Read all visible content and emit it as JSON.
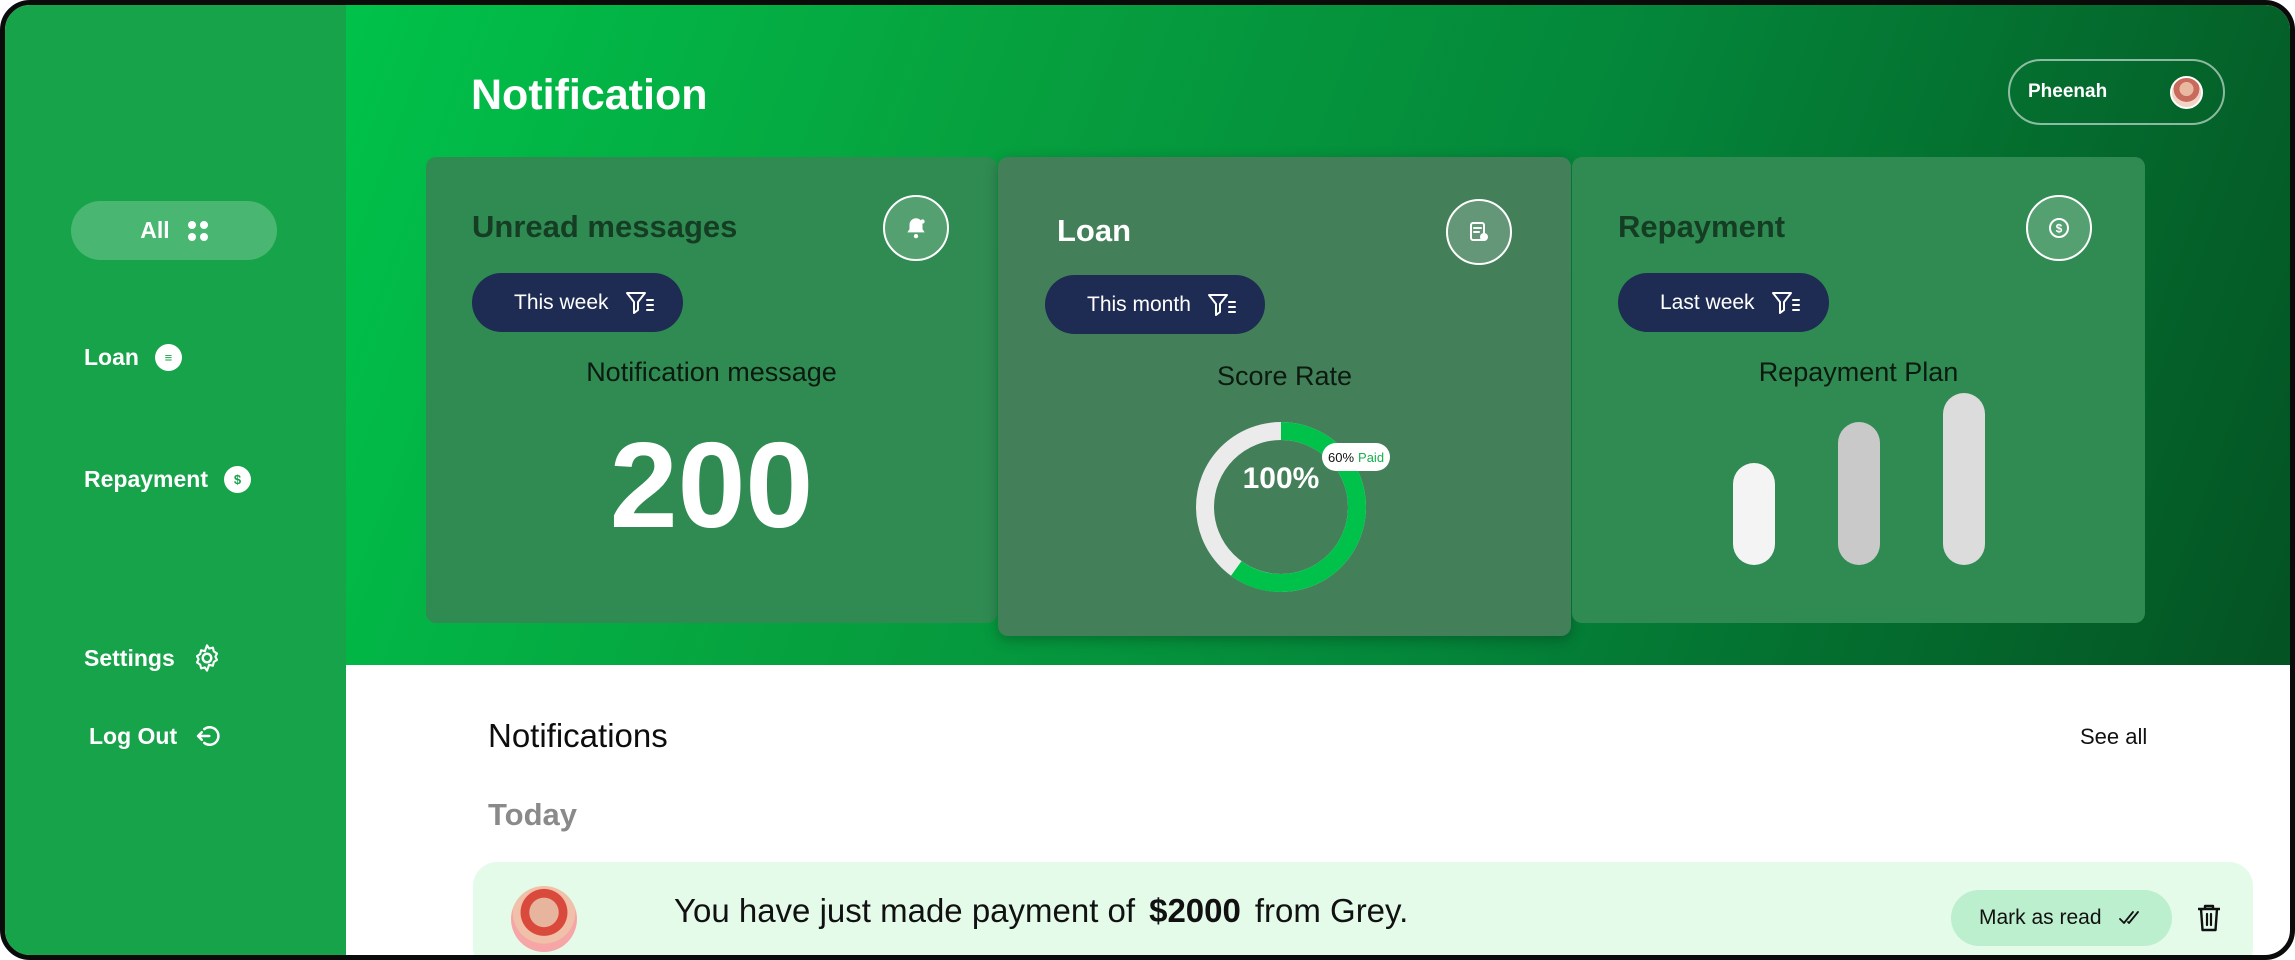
{
  "app": {
    "page_title": "Notification"
  },
  "user": {
    "name": "Pheenah"
  },
  "sidebar": {
    "items": [
      {
        "label": "All"
      },
      {
        "label": "Loan"
      },
      {
        "label": "Repayment"
      },
      {
        "label": "Settings"
      },
      {
        "label": "Log Out"
      }
    ]
  },
  "cards": {
    "unread": {
      "title": "Unread messages",
      "filter": "This week",
      "label": "Notification message",
      "value": "200"
    },
    "loan": {
      "title": "Loan",
      "filter": "This month",
      "label": "Score Rate",
      "center": "100%",
      "badge_pct": "60%",
      "badge_text": "Paid",
      "paid_fraction": 0.6
    },
    "repayment": {
      "title": "Repayment",
      "filter": "Last week",
      "label": "Repayment Plan",
      "bar_levels": [
        0.58,
        0.81,
        0.98
      ]
    }
  },
  "notifications": {
    "title": "Notifications",
    "see_all": "See all",
    "group": "Today",
    "items": [
      {
        "text_before": "You have just made payment of",
        "amount": "$2000",
        "text_after": "from Grey.",
        "action": "Mark as read"
      }
    ]
  },
  "colors": {
    "sidebar": "#17a34a",
    "accent_green": "#00c24a",
    "navy": "#1e2b52",
    "row_bg": "#e4fbea"
  }
}
